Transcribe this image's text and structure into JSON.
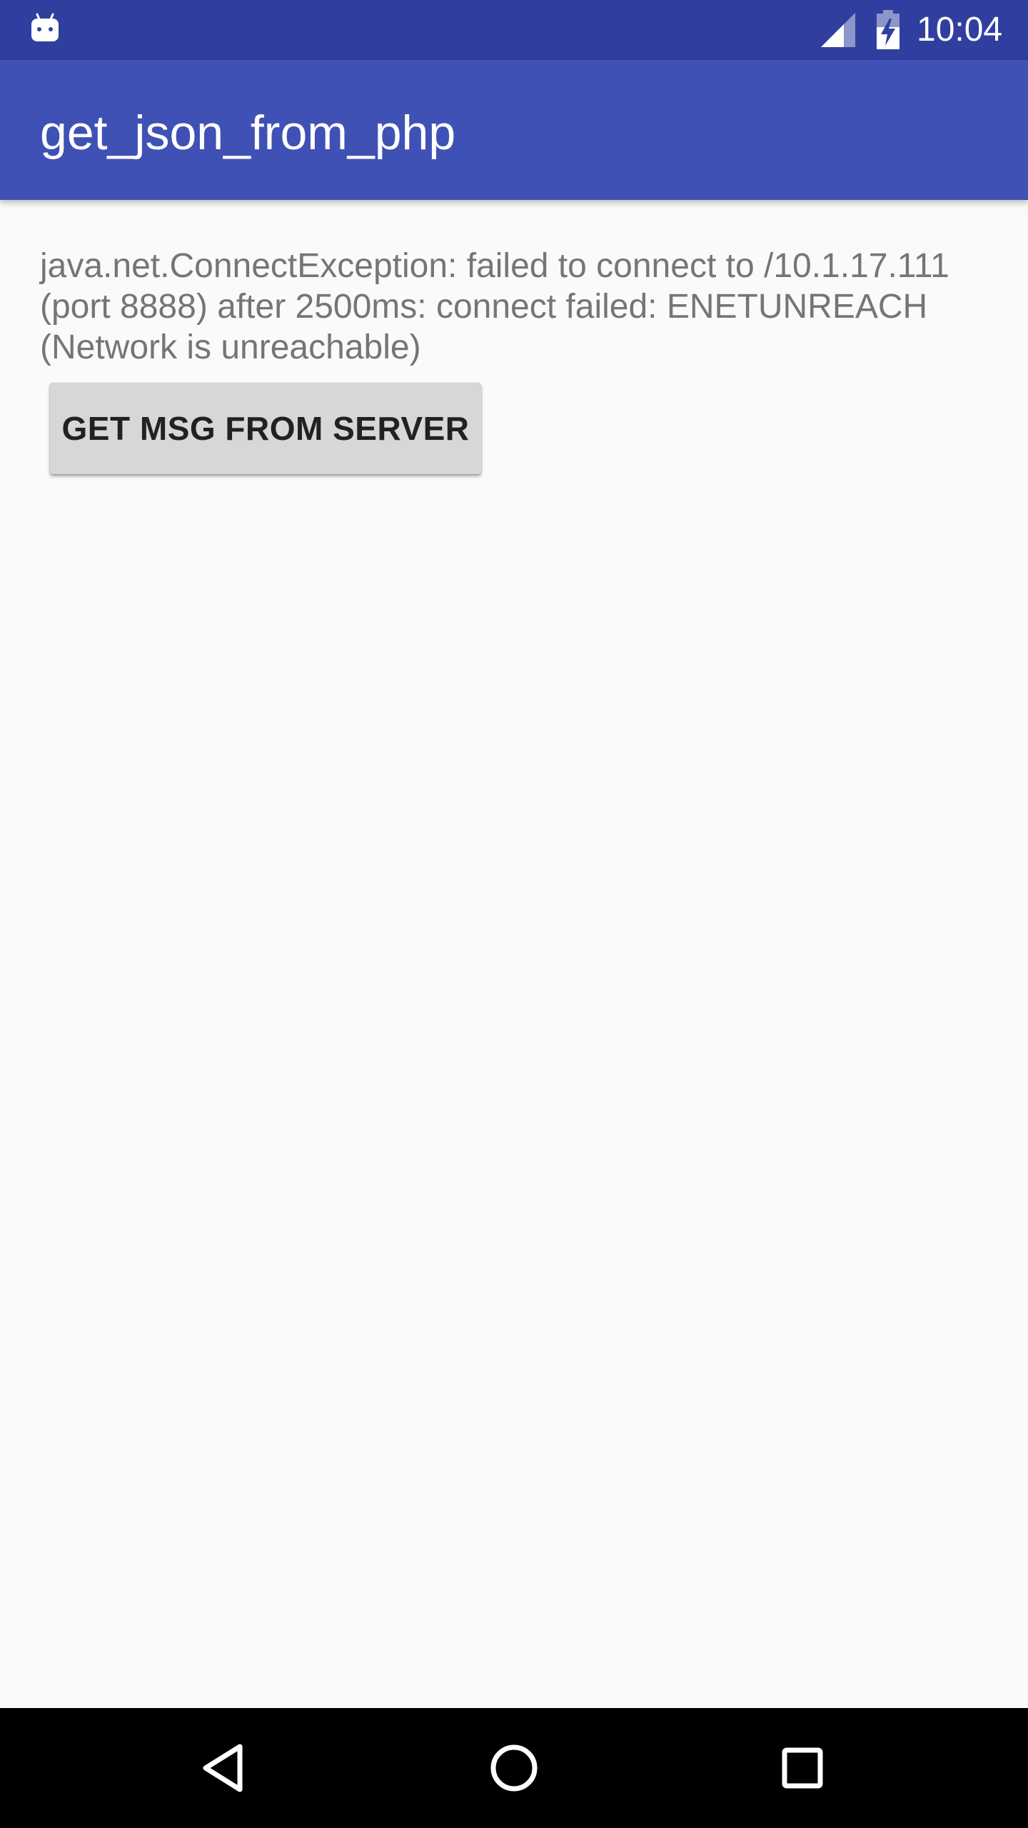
{
  "status_bar": {
    "time": "10:04",
    "notification_icon": "android-debug-icon",
    "signal_icon": "cell-signal-icon",
    "battery_icon": "battery-charging-icon"
  },
  "app_bar": {
    "title": "get_json_from_php",
    "color": "#3f51b5"
  },
  "content": {
    "message": "java.net.ConnectException: failed to connect to /10.1.17.111\n(port 8888) after 2500ms: connect failed: ENETUNREACH\n(Network is unreachable)",
    "button_label": "GET MSG FROM SERVER"
  },
  "nav_bar": {
    "back_icon": "back-triangle-icon",
    "home_icon": "home-circle-icon",
    "recents_icon": "recents-square-icon"
  },
  "colors": {
    "status_bar": "#303f9f",
    "app_bar": "#3f51b5",
    "background": "#fafafa",
    "button": "#d6d7d7",
    "message_text": "#757575"
  }
}
